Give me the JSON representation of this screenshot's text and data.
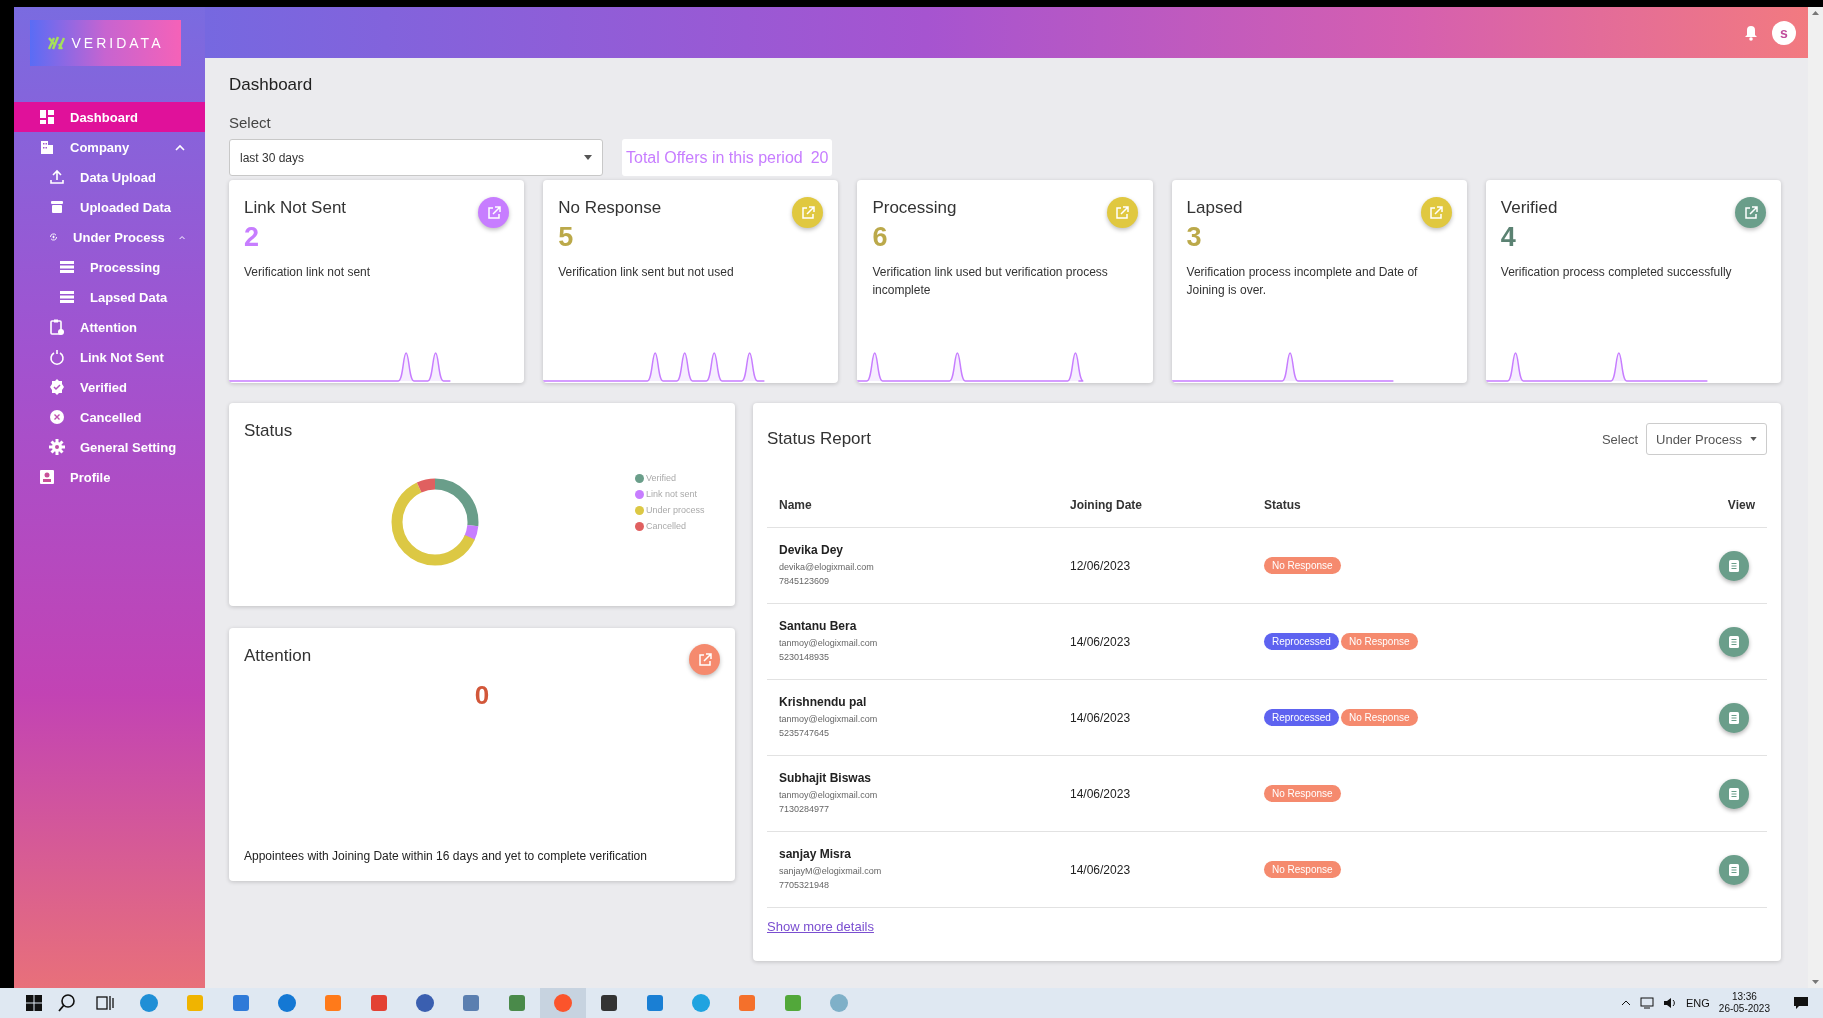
{
  "sidebar": {
    "logo": "VERIDATA",
    "items": [
      {
        "label": "Dashboard",
        "selected": true
      },
      {
        "label": "Company",
        "selected": false,
        "expanded": true,
        "children": [
          {
            "label": "Data Upload",
            "selected": false
          },
          {
            "label": "Uploaded Data",
            "selected": false
          },
          {
            "label": "Under Process",
            "selected": false,
            "expanded": true,
            "children": [
              {
                "label": "Processing",
                "selected": false
              },
              {
                "label": "Lapsed Data",
                "selected": false
              }
            ]
          },
          {
            "label": "Attention",
            "selected": false
          },
          {
            "label": "Link Not Sent",
            "selected": false
          },
          {
            "label": "Verified",
            "selected": false
          },
          {
            "label": "Cancelled",
            "selected": false
          },
          {
            "label": "General Setting",
            "selected": false
          }
        ]
      },
      {
        "label": "Profile",
        "selected": false
      }
    ]
  },
  "header": {
    "avatar": "s"
  },
  "page_title": "Dashboard",
  "period": {
    "label": "Select",
    "value": "last 30 days",
    "total_label": "Total Offers in this period",
    "total": "20"
  },
  "cards": [
    {
      "title": "Link Not Sent",
      "count": "2",
      "description": "Verification link not sent",
      "color": "#c77dff"
    },
    {
      "title": "No Response",
      "count": "5",
      "description": "Verification link sent but not used",
      "color": "#e0c840"
    },
    {
      "title": "Processing",
      "count": "6",
      "description": "Verification link used but verification process incomplete",
      "color": "#e0c840"
    },
    {
      "title": "Lapsed",
      "count": "3",
      "description": "Verification process incomplete and Date of Joining is over.",
      "color": "#e0c840"
    },
    {
      "title": "Verified",
      "count": "4",
      "description": "Verification process completed successfully",
      "color": "#6a9e8a"
    }
  ],
  "status": {
    "title": "Status",
    "legend": [
      {
        "label": "Verified",
        "color": "#6a9e8a"
      },
      {
        "label": "Link not sent",
        "color": "#c77dff"
      },
      {
        "label": "Under process",
        "color": "#dcc844"
      },
      {
        "label": "Cancelled",
        "color": "#e06060"
      }
    ]
  },
  "attention": {
    "title": "Attention",
    "count": "0",
    "note": "Appointees with Joining Date within 16 days and yet to complete verification"
  },
  "report": {
    "title": "Status Report",
    "filter_label": "Select",
    "filter_value": "Under Process",
    "columns": [
      "Name",
      "Joining Date",
      "Status",
      "View"
    ],
    "rows": [
      {
        "name": "Devika Dey",
        "email": "devika@elogixmail.com",
        "phone": "7845123609",
        "joining_date": "12/06/2023",
        "tags": [
          {
            "label": "No Response",
            "color": "#f58a6e"
          }
        ]
      },
      {
        "name": "Santanu Bera",
        "email": "tanmoy@elogixmail.com",
        "phone": "5230148935",
        "joining_date": "14/06/2023",
        "tags": [
          {
            "label": "Reprocessed",
            "color": "#5e63f0"
          },
          {
            "label": "No Response",
            "color": "#f58a6e"
          }
        ]
      },
      {
        "name": "Krishnendu pal",
        "email": "tanmoy@elogixmail.com",
        "phone": "5235747645",
        "joining_date": "14/06/2023",
        "tags": [
          {
            "label": "Reprocessed",
            "color": "#5e63f0"
          },
          {
            "label": "No Response",
            "color": "#f58a6e"
          }
        ]
      },
      {
        "name": "Subhajit Biswas",
        "email": "tanmoy@elogixmail.com",
        "phone": "7130284977",
        "joining_date": "14/06/2023",
        "tags": [
          {
            "label": "No Response",
            "color": "#f58a6e"
          }
        ]
      },
      {
        "name": "sanjay Misra",
        "email": "sanjayM@elogixmail.com",
        "phone": "7705321948",
        "joining_date": "14/06/2023",
        "tags": [
          {
            "label": "No Response",
            "color": "#f58a6e"
          }
        ]
      }
    ],
    "more_link": "Show more details"
  },
  "taskbar": {
    "apps": [
      {
        "selected": false
      },
      {
        "selected": false
      },
      {
        "selected": false
      },
      {
        "selected": false
      },
      {
        "selected": false
      },
      {
        "selected": false
      },
      {
        "selected": false
      },
      {
        "selected": false
      },
      {
        "selected": false
      },
      {
        "selected": true
      },
      {
        "selected": false
      },
      {
        "selected": false
      },
      {
        "selected": false
      },
      {
        "selected": false
      },
      {
        "selected": false
      },
      {
        "selected": false
      }
    ],
    "language": "ENG",
    "time": "13:36",
    "date": "26-05-2023"
  }
}
